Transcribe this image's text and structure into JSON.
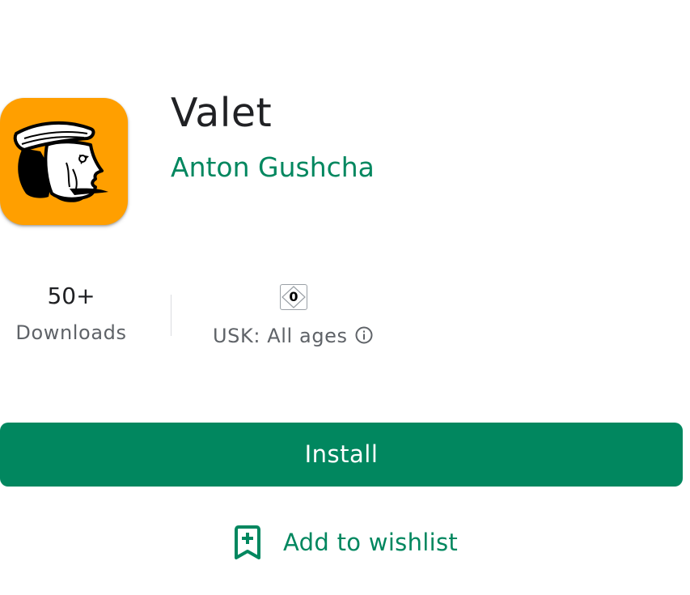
{
  "app": {
    "title": "Valet",
    "developer": "Anton Gushcha",
    "icon": "knave-portrait-icon",
    "icon_background": "#ff9f00"
  },
  "stats": {
    "downloads_value": "50+",
    "downloads_label": "Downloads",
    "rating_badge": "0",
    "rating_label": "USK: All ages",
    "rating_info_icon": "info-circle-icon"
  },
  "actions": {
    "install_label": "Install",
    "wishlist_label": "Add to wishlist",
    "wishlist_icon": "bookmark-add-icon"
  },
  "colors": {
    "accent": "#01875f",
    "title": "#202124",
    "secondary_text": "#5f6368"
  }
}
